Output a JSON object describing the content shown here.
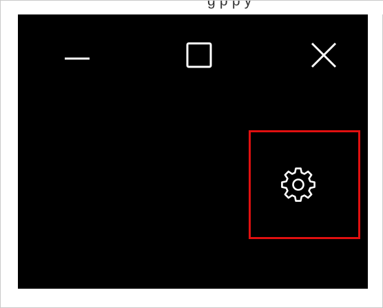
{
  "top_strip": {
    "partial_text": "g  p   p  y"
  },
  "window": {
    "background": "#000000",
    "caption_buttons": [
      {
        "name": "minimize",
        "icon": "minimize-icon"
      },
      {
        "name": "maximize",
        "icon": "maximize-icon"
      },
      {
        "name": "close",
        "icon": "close-icon"
      }
    ],
    "settings": {
      "icon": "gear-icon",
      "highlighted": true,
      "highlight_color": "#e01010"
    }
  },
  "colors": {
    "icon_color": "#ffffff",
    "frame_border": "#c8c8c8"
  }
}
